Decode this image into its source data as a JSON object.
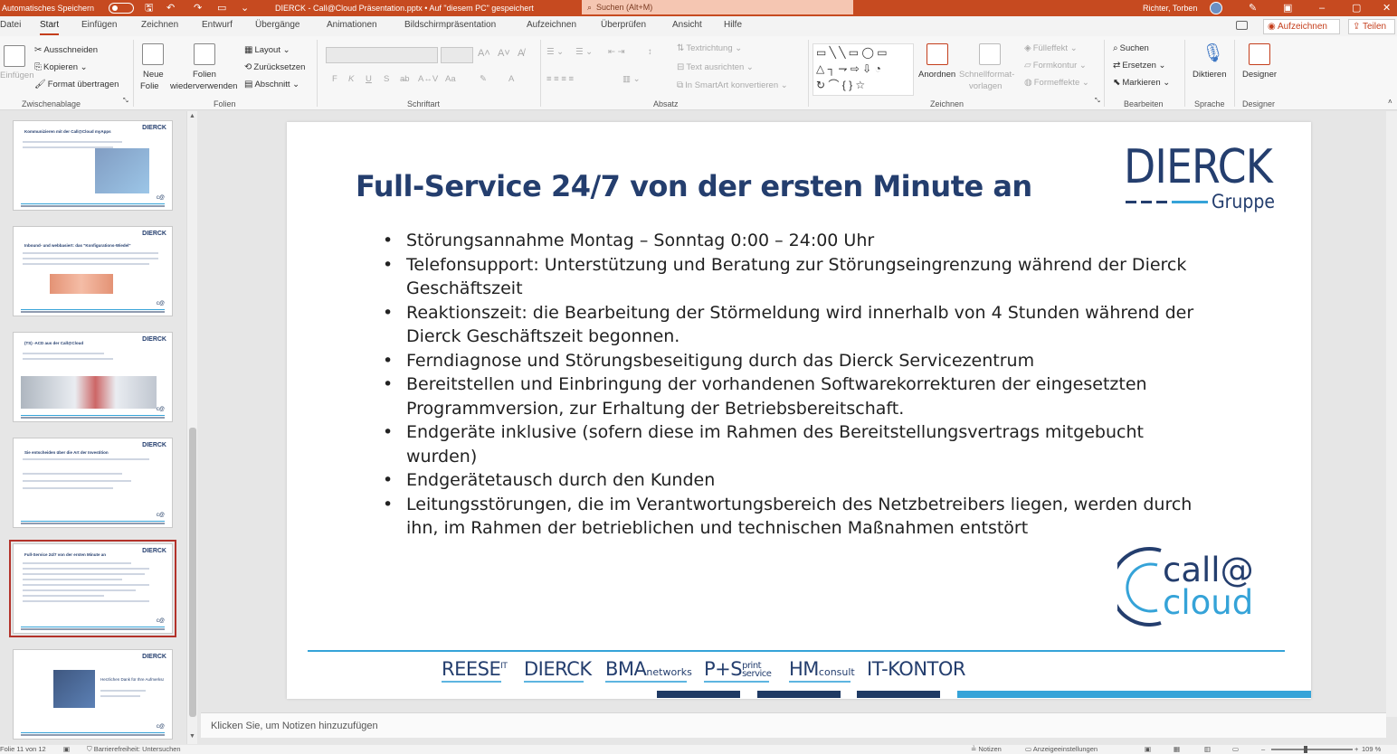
{
  "titlebar": {
    "autosave_label": "Automatisches Speichern",
    "file_title": "DIERCK - Call@Cloud Präsentation.pptx • Auf \"diesem PC\" gespeichert",
    "search_placeholder": "Suchen (Alt+M)",
    "user_name": "Richter, Torben",
    "window_controls": [
      "minimize-icon",
      "restore-icon",
      "close-icon"
    ]
  },
  "tabs": {
    "items": [
      "Datei",
      "Start",
      "Einfügen",
      "Zeichnen",
      "Entwurf",
      "Übergänge",
      "Animationen",
      "Bildschirmpräsentation",
      "Aufzeichnen",
      "Überprüfen",
      "Ansicht",
      "Hilfe"
    ],
    "active": "Start",
    "record_button": "Aufzeichnen",
    "share_button": "Teilen"
  },
  "ribbon": {
    "clipboard": {
      "paste": "Einfügen",
      "cut": "Ausschneiden",
      "copy": "Kopieren",
      "format_painter": "Format übertragen",
      "group": "Zwischenablage"
    },
    "slides": {
      "new_slide_line1": "Neue",
      "new_slide_line2": "Folie",
      "reuse_line1": "Folien",
      "reuse_line2": "wiederverwenden",
      "layout": "Layout",
      "reset": "Zurücksetzen",
      "section": "Abschnitt",
      "group": "Folien"
    },
    "font": {
      "bold": "F",
      "italic": "K",
      "underline": "U",
      "strike": "S",
      "group": "Schriftart"
    },
    "paragraph": {
      "text_direction": "Textrichtung",
      "align_text": "Text ausrichten",
      "smartart": "In SmartArt konvertieren",
      "group": "Absatz"
    },
    "drawing": {
      "arrange": "Anordnen",
      "quick_styles_line1": "Schnellformat-",
      "quick_styles_line2": "vorlagen",
      "fill": "Fülleffekt",
      "outline": "Formkontur",
      "effects": "Formeffekte",
      "group": "Zeichnen"
    },
    "editing": {
      "find": "Suchen",
      "replace": "Ersetzen",
      "select": "Markieren",
      "group": "Bearbeiten"
    },
    "voice": {
      "dictate": "Diktieren",
      "group": "Sprache"
    },
    "designer": {
      "label": "Designer",
      "group": "Designer"
    }
  },
  "thumbnails": [
    {
      "num": "",
      "title": "Kommunizieren mit der Call@Cloud myApps",
      "selected": false
    },
    {
      "num": "",
      "title": "Inbound- und webbasiert: das \"Konfigurations-Wiedel\"",
      "selected": false
    },
    {
      "num": "",
      "title": "(TS) -ACD aus der Call@Cloud",
      "selected": false
    },
    {
      "num": "",
      "title": "Sie entscheiden über die Art der Investition",
      "selected": false
    },
    {
      "num": "",
      "title": "Full-Service 24/7 von der ersten Minute an",
      "selected": true
    },
    {
      "num": "",
      "title": "Herzlichen Dank für Ihre Aufmerksamkeit",
      "selected": false
    }
  ],
  "slide": {
    "title": "Full-Service 24/7 von der ersten Minute an",
    "logo_text": "DIERCK",
    "logo_sub": "Gruppe",
    "bullets": [
      "Störungsannahme Montag – Sonntag 0:00 – 24:00 Uhr",
      "Telefonsupport: Unterstützung und Beratung zur Störungseingrenzung während der Dierck Geschäftszeit",
      "Reaktionszeit: die Bearbeitung der Störmeldung wird innerhalb von 4 Stunden während der Dierck Geschäftszeit begonnen.",
      "Ferndiagnose und Störungsbeseitigung durch das Dierck Servicezentrum",
      "Bereitstellen und Einbringung der vorhandenen Softwarekorrekturen der eingesetzten Programmversion, zur Erhaltung der Betriebsbereitschaft.",
      "Endgeräte inklusive (sofern diese im Rahmen des Bereitstellungsvertrags mitgebucht wurden)",
      "Endgerätetausch durch den Kunden",
      "Leitungsstörungen, die im Verantwortungsbereich des Netzbetreibers liegen, werden durch ihn, im Rahmen der betrieblichen und technischen Maßnahmen entstört"
    ],
    "cc_logo_call": "call@",
    "cc_logo_cloud": "cloud",
    "partners": {
      "reese": "REESE",
      "reese_sup": "IT",
      "dierck": "DIERCK",
      "bma": "BMA",
      "bma_small": "networks",
      "ps": "P+S",
      "ps_small_top": "print",
      "ps_small_bottom": "service",
      "hm": "HM",
      "hm_small": "consult",
      "itkontor": "IT-KONTOR"
    }
  },
  "notes": {
    "placeholder": "Klicken Sie, um Notizen hinzuzufügen"
  },
  "statusbar": {
    "slide_counter": "Folie 11 von 12",
    "accessibility": "Barrierefreiheit: Untersuchen",
    "notes_btn": "Notizen",
    "display_settings": "Anzeigeeinstellungen",
    "zoom": "109 %"
  },
  "colors": {
    "accent": "#c43e1c",
    "brand_navy": "#243e6e",
    "brand_blue": "#35a3d8"
  }
}
